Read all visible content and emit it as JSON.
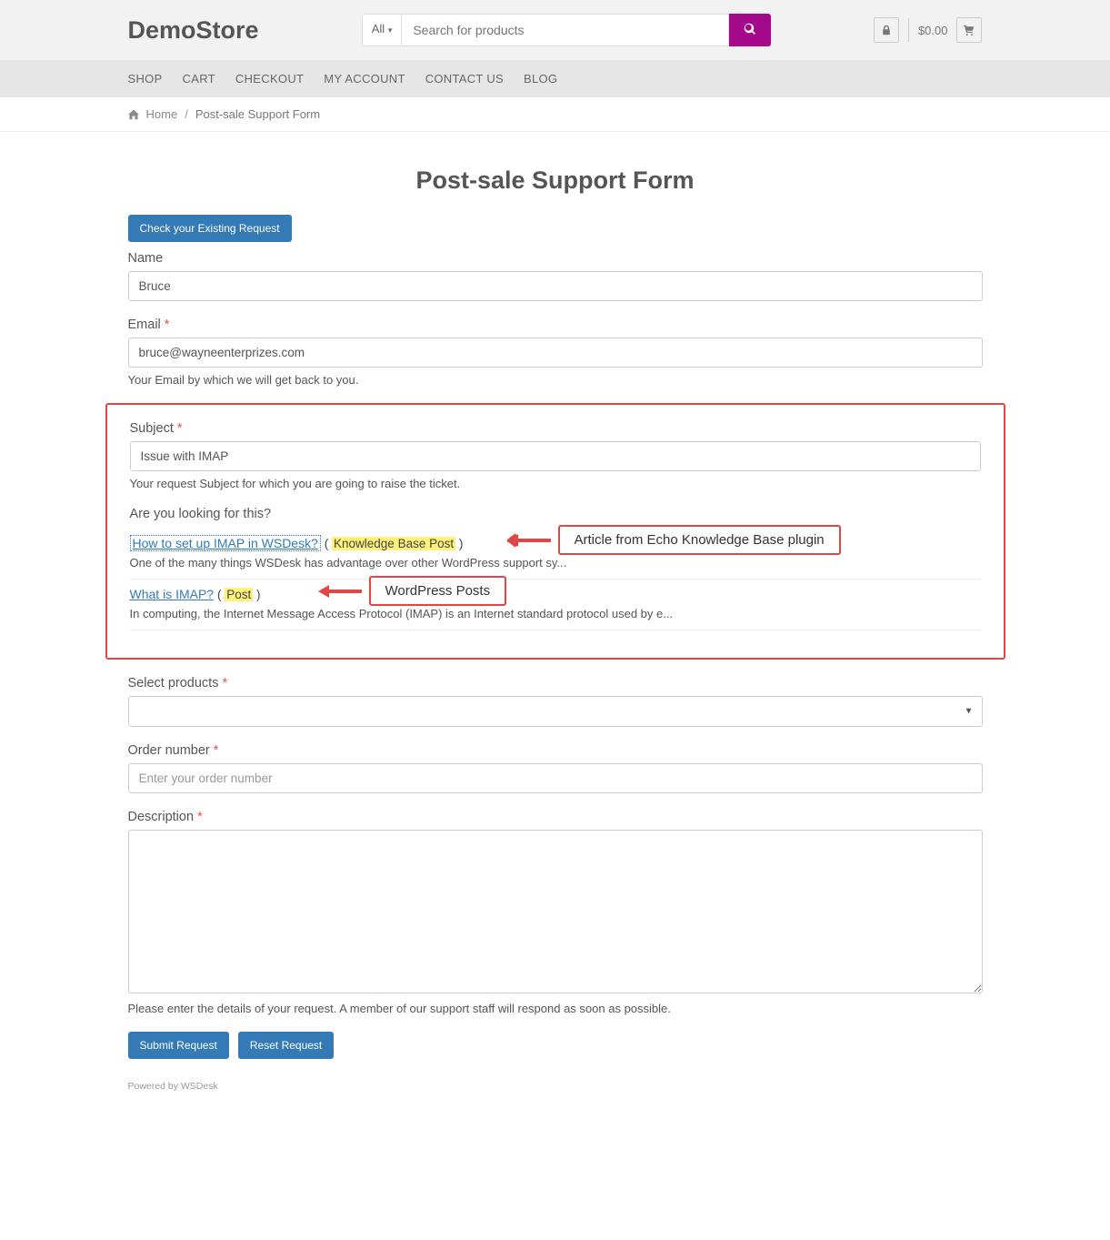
{
  "header": {
    "logo": "DemoStore",
    "search_filter": "All",
    "search_placeholder": "Search for products",
    "cart_price": "$0.00"
  },
  "nav": [
    "SHOP",
    "CART",
    "CHECKOUT",
    "MY ACCOUNT",
    "CONTACT US",
    "BLOG"
  ],
  "breadcrumb": {
    "home": "Home",
    "current": "Post-sale Support Form"
  },
  "page_title": "Post-sale Support Form",
  "check_btn": "Check your Existing Request",
  "fields": {
    "name": {
      "label": "Name",
      "value": "Bruce"
    },
    "email": {
      "label": "Email",
      "value": "bruce@wayneenterprizes.com",
      "help": "Your Email by which we will get back to you."
    },
    "subject": {
      "label": "Subject",
      "value": "Issue with IMAP",
      "help": "Your request Subject for which you are going to raise the ticket."
    },
    "products": {
      "label": "Select products"
    },
    "order": {
      "label": "Order number",
      "placeholder": "Enter your order number"
    },
    "description": {
      "label": "Description",
      "help": "Please enter the details of your request. A member of our support staff will respond as soon as possible."
    }
  },
  "suggestions": {
    "title": "Are you looking for this?",
    "items": [
      {
        "link": "How to set up IMAP in WSDesk?",
        "category": "Knowledge Base Post",
        "excerpt": "One of the many things WSDesk has advantage over other WordPress support sy...",
        "callout": "Article from Echo Knowledge Base plugin"
      },
      {
        "link": "What is IMAP?",
        "category": "Post",
        "excerpt": "In computing, the Internet Message Access Protocol (IMAP) is an Internet standard protocol used by e...",
        "callout": "WordPress Posts"
      }
    ]
  },
  "buttons": {
    "submit": "Submit Request",
    "reset": "Reset Request"
  },
  "powered": "Powered by WSDesk"
}
